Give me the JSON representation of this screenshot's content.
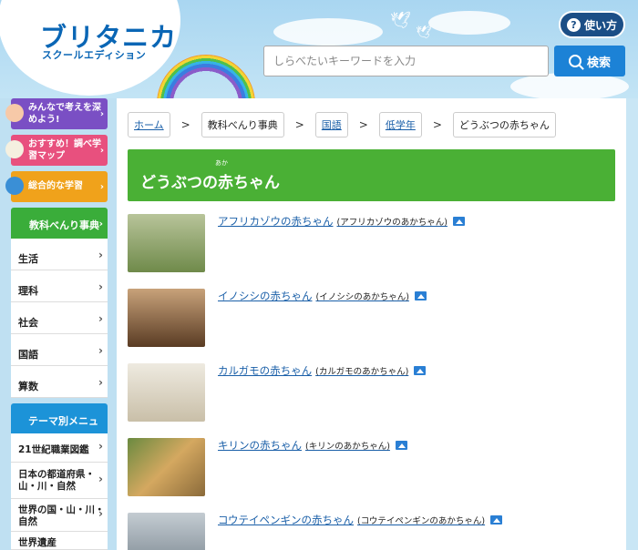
{
  "header": {
    "logo_main": "ブリタニカ",
    "logo_sub": "スクールエディション",
    "help_label": "使い方",
    "search": {
      "placeholder": "しらべたいキーワードを入力",
      "button_label": "検索"
    }
  },
  "sidebar": {
    "promos": [
      {
        "label": "みんなで考えを深めよう!",
        "color": "#7a4fc4"
      },
      {
        "label": "おすすめ！調べ学習マップ",
        "color": "#e8507e"
      },
      {
        "label": "総合的な学習",
        "color": "#f0a21b"
      }
    ],
    "category_title": "教科べんり事典",
    "subjects": [
      "生活",
      "理科",
      "社会",
      "国語",
      "算数"
    ],
    "theme_title": "テーマ別メニュー",
    "themes": [
      "21世紀職業図鑑",
      "日本の都道府県・山・川・自然",
      "世界の国・山・川・自然",
      "世界遺産"
    ]
  },
  "breadcrumb": [
    "ホーム",
    "教科べんり事典",
    "国語",
    "低学年",
    "どうぶつの赤ちゃん"
  ],
  "page_title": "どうぶつの赤ちゃん",
  "page_title_furigana": "あか",
  "articles": [
    {
      "title": "アフリカゾウの赤ちゃん",
      "kana": "(アフリカゾウのあかちゃん)",
      "thumb_color": "#8a9a72"
    },
    {
      "title": "イノシシの赤ちゃん",
      "kana": "(イノシシのあかちゃん)",
      "thumb_color": "#7a5a3c"
    },
    {
      "title": "カルガモの赤ちゃん",
      "kana": "(カルガモのあかちゃん)",
      "thumb_color": "#d9d2c2"
    },
    {
      "title": "キリンの赤ちゃん",
      "kana": "(キリンのあかちゃん)",
      "thumb_color": "#c49a5a"
    },
    {
      "title": "コウテイペンギンの赤ちゃん",
      "kana": "(コウテイペンギンのあかちゃん)",
      "thumb_color": "#9aa6b0"
    }
  ]
}
